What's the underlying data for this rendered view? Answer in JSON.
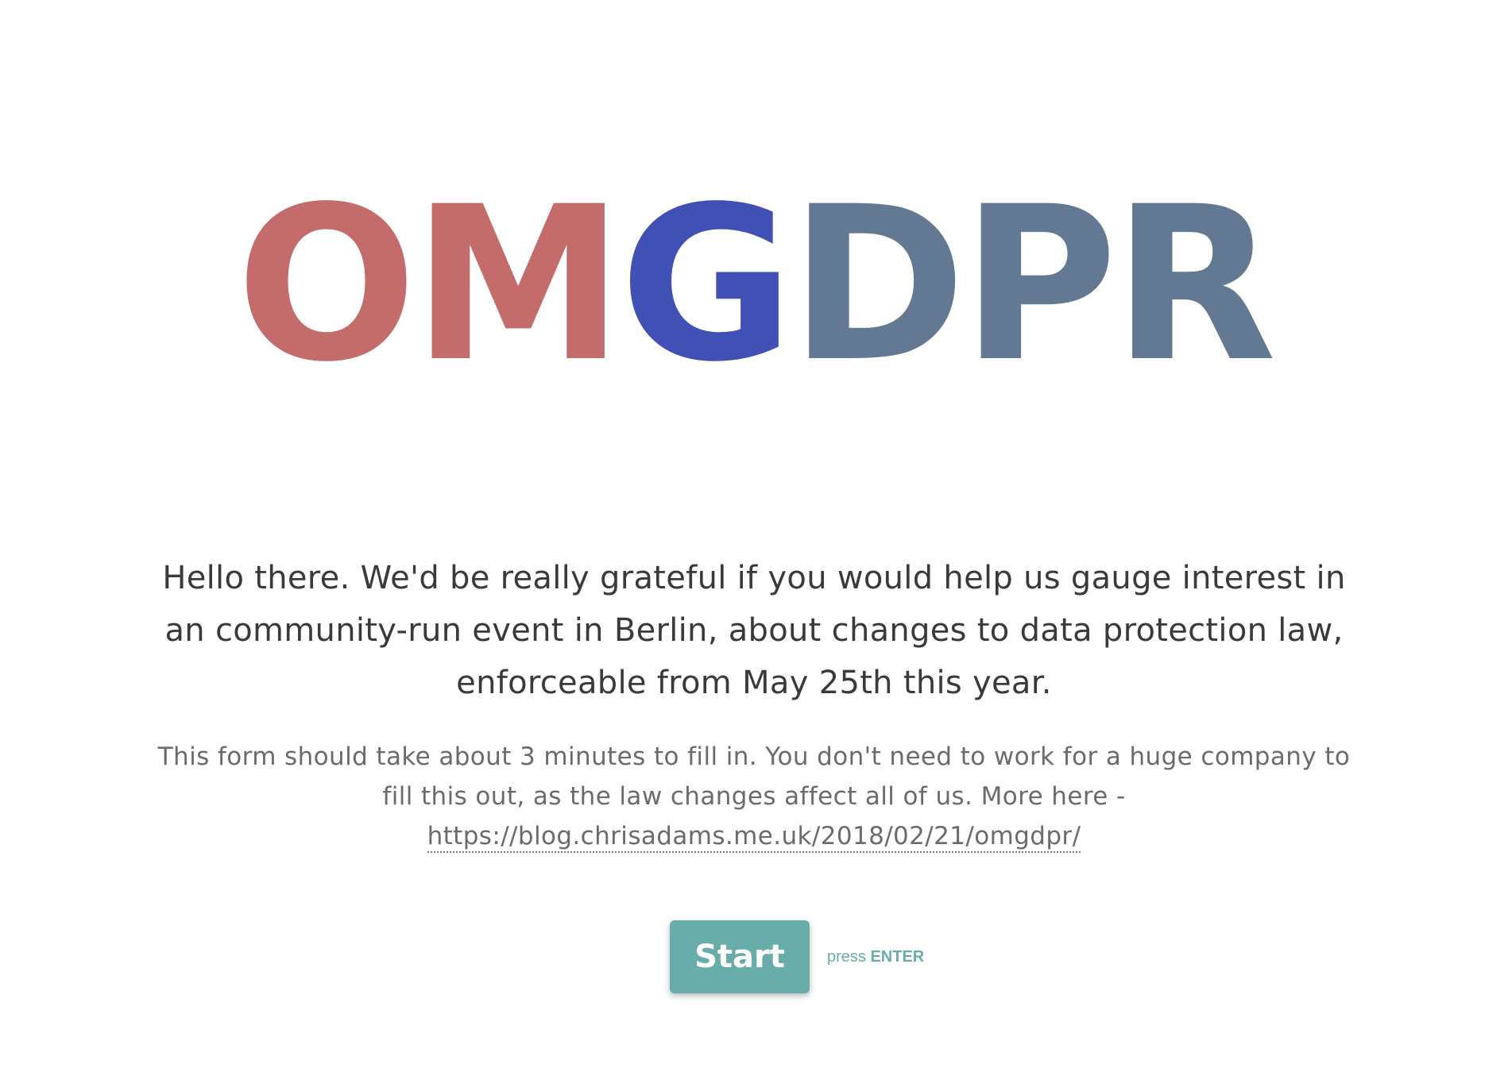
{
  "logo": {
    "parts": [
      {
        "text": "OM",
        "color": "#c46b6b"
      },
      {
        "text": "G",
        "color": "#4150b5"
      },
      {
        "text": "DPR",
        "color": "#637892"
      }
    ]
  },
  "intro": {
    "welcome_text": "Hello there. We'd be really grateful if you would help us gauge interest in an community-run event in Berlin, about changes to data protection law, enforceable from May 25th this year.",
    "description_text": "This form should take about 3 minutes to fill in. You don't need to work for a huge company to fill this out, as the law changes affect all of us. More here -",
    "link_text": "https://blog.chrisadams.me.uk/2018/02/21/omgdpr/"
  },
  "cta": {
    "button_label": "Start",
    "hint_prefix": "press",
    "hint_key": "ENTER"
  },
  "colors": {
    "accent": "#68ada9",
    "text_primary": "#3a3a3a",
    "text_secondary": "#6b6b6b",
    "background": "#ffffff"
  }
}
